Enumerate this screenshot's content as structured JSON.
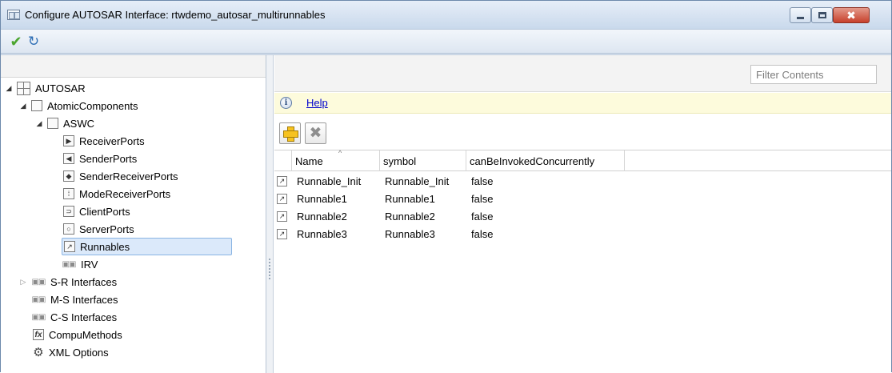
{
  "window": {
    "title": "Configure AUTOSAR Interface: rtwdemo_autosar_multirunnables",
    "controls": {
      "minimize": "minimize",
      "maximize": "maximize",
      "close": "✖"
    }
  },
  "toolbar": {
    "apply_icon": "checkmark-icon",
    "refresh_icon": "refresh-icon"
  },
  "tree": {
    "root": "AUTOSAR",
    "atomic_components": "AtomicComponents",
    "component": "ASWC",
    "ports": [
      "ReceiverPorts",
      "SenderPorts",
      "SenderReceiverPorts",
      "ModeReceiverPorts",
      "ClientPorts",
      "ServerPorts"
    ],
    "runnables": "Runnables",
    "irv": "IRV",
    "sr_interfaces": "S-R Interfaces",
    "ms_interfaces": "M-S Interfaces",
    "cs_interfaces": "C-S Interfaces",
    "compu_methods": "CompuMethods",
    "xml_options": "XML Options"
  },
  "filter": {
    "placeholder": "Filter Contents"
  },
  "help": {
    "label": "Help",
    "icon": "info-icon"
  },
  "actions": {
    "add_icon": "add-icon",
    "delete_icon": "delete-icon"
  },
  "table": {
    "columns": [
      "Name",
      "symbol",
      "canBeInvokedConcurrently"
    ],
    "sort_column": "Name",
    "rows": [
      {
        "name": "Runnable_Init",
        "symbol": "Runnable_Init",
        "concurrent": "false"
      },
      {
        "name": "Runnable1",
        "symbol": "Runnable1",
        "concurrent": "false"
      },
      {
        "name": "Runnable2",
        "symbol": "Runnable2",
        "concurrent": "false"
      },
      {
        "name": "Runnable3",
        "symbol": "Runnable3",
        "concurrent": "false"
      }
    ]
  },
  "colors": {
    "selection": "#dbe9fa",
    "help_bar": "#fdfbdc",
    "link": "#0000cc",
    "close_button": "#c7412c"
  }
}
